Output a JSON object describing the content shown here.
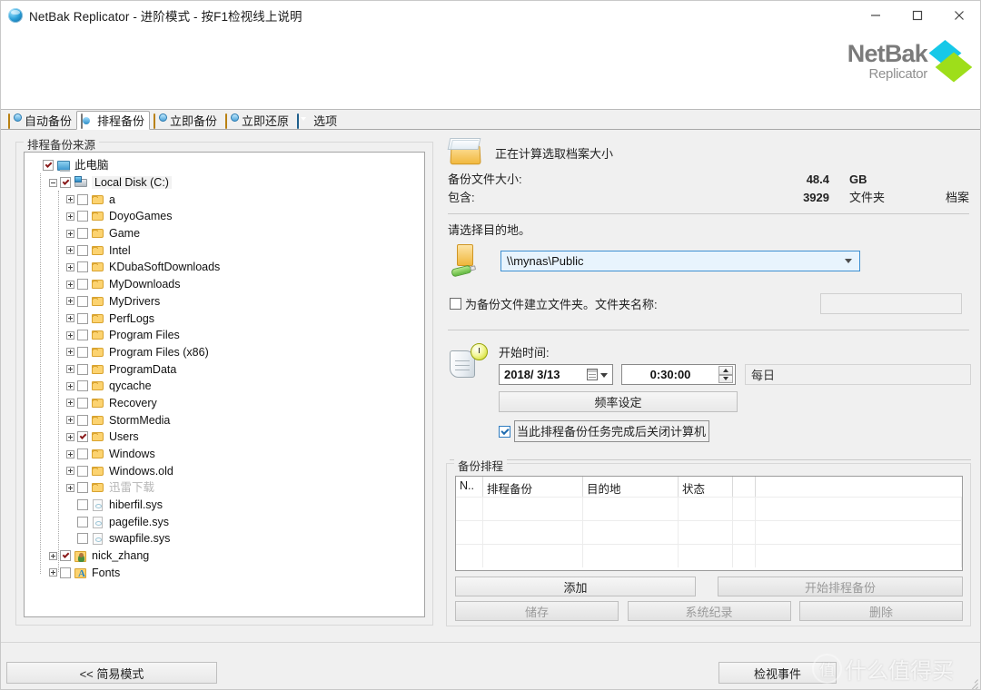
{
  "window": {
    "title": "NetBak Replicator - 进阶模式 - 按F1检视线上说明",
    "icon": "app-globe-icon",
    "minimize": "−",
    "maximize": "□",
    "close": "✕"
  },
  "brand": {
    "name": "NetBak",
    "subtitle": "Replicator",
    "accent_cyan": "#16c8e8",
    "accent_green": "#9ede1a"
  },
  "tabs": [
    {
      "label": "自动备份",
      "icon": "auto-backup-icon",
      "active": false
    },
    {
      "label": "排程备份",
      "icon": "schedule-backup-icon",
      "active": true
    },
    {
      "label": "立即备份",
      "icon": "backup-now-icon",
      "active": false
    },
    {
      "label": "立即还原",
      "icon": "restore-now-icon",
      "active": false
    },
    {
      "label": "选项",
      "icon": "options-icon",
      "active": false
    }
  ],
  "source_group": {
    "title": "排程备份来源",
    "tree": [
      {
        "label": "此电脑",
        "depth": 0,
        "checked": true,
        "expander": "none",
        "icon": "computer-icon",
        "selected": false,
        "dim": false
      },
      {
        "label": "Local Disk (C:)",
        "depth": 1,
        "checked": true,
        "expander": "minus",
        "icon": "drive-icon",
        "selected": true,
        "dim": false
      },
      {
        "label": "a",
        "depth": 2,
        "checked": false,
        "expander": "plus",
        "icon": "folder-icon",
        "selected": false,
        "dim": false
      },
      {
        "label": "DoyoGames",
        "depth": 2,
        "checked": false,
        "expander": "plus",
        "icon": "folder-icon",
        "selected": false,
        "dim": false
      },
      {
        "label": "Game",
        "depth": 2,
        "checked": false,
        "expander": "plus",
        "icon": "folder-icon",
        "selected": false,
        "dim": false
      },
      {
        "label": "Intel",
        "depth": 2,
        "checked": false,
        "expander": "plus",
        "icon": "folder-icon",
        "selected": false,
        "dim": false
      },
      {
        "label": "KDubaSoftDownloads",
        "depth": 2,
        "checked": false,
        "expander": "plus",
        "icon": "folder-icon",
        "selected": false,
        "dim": false
      },
      {
        "label": "MyDownloads",
        "depth": 2,
        "checked": false,
        "expander": "plus",
        "icon": "folder-icon",
        "selected": false,
        "dim": false
      },
      {
        "label": "MyDrivers",
        "depth": 2,
        "checked": false,
        "expander": "plus",
        "icon": "folder-icon",
        "selected": false,
        "dim": false
      },
      {
        "label": "PerfLogs",
        "depth": 2,
        "checked": false,
        "expander": "plus",
        "icon": "folder-icon",
        "selected": false,
        "dim": false
      },
      {
        "label": "Program Files",
        "depth": 2,
        "checked": false,
        "expander": "plus",
        "icon": "folder-icon",
        "selected": false,
        "dim": false
      },
      {
        "label": "Program Files (x86)",
        "depth": 2,
        "checked": false,
        "expander": "plus",
        "icon": "folder-icon",
        "selected": false,
        "dim": false
      },
      {
        "label": "ProgramData",
        "depth": 2,
        "checked": false,
        "expander": "plus",
        "icon": "folder-icon",
        "selected": false,
        "dim": false
      },
      {
        "label": "qycache",
        "depth": 2,
        "checked": false,
        "expander": "plus",
        "icon": "folder-icon",
        "selected": false,
        "dim": false
      },
      {
        "label": "Recovery",
        "depth": 2,
        "checked": false,
        "expander": "plus",
        "icon": "folder-icon",
        "selected": false,
        "dim": false
      },
      {
        "label": "StormMedia",
        "depth": 2,
        "checked": false,
        "expander": "plus",
        "icon": "folder-icon",
        "selected": false,
        "dim": false
      },
      {
        "label": "Users",
        "depth": 2,
        "checked": true,
        "expander": "plus",
        "icon": "folder-icon",
        "selected": false,
        "dim": false
      },
      {
        "label": "Windows",
        "depth": 2,
        "checked": false,
        "expander": "plus",
        "icon": "folder-icon",
        "selected": false,
        "dim": false
      },
      {
        "label": "Windows.old",
        "depth": 2,
        "checked": false,
        "expander": "plus",
        "icon": "folder-icon",
        "selected": false,
        "dim": false
      },
      {
        "label": "迅雷下载",
        "depth": 2,
        "checked": false,
        "expander": "plus",
        "icon": "folder-icon",
        "selected": false,
        "dim": true
      },
      {
        "label": "hiberfil.sys",
        "depth": 2,
        "checked": false,
        "expander": "none",
        "icon": "file-icon",
        "selected": false,
        "dim": false
      },
      {
        "label": "pagefile.sys",
        "depth": 2,
        "checked": false,
        "expander": "none",
        "icon": "file-icon",
        "selected": false,
        "dim": false
      },
      {
        "label": "swapfile.sys",
        "depth": 2,
        "checked": false,
        "expander": "none",
        "icon": "file-icon",
        "selected": false,
        "dim": false
      },
      {
        "label": "nick_zhang",
        "depth": 1,
        "checked": true,
        "expander": "plus",
        "icon": "user-folder-icon",
        "selected": false,
        "dim": false
      },
      {
        "label": "Fonts",
        "depth": 1,
        "checked": false,
        "expander": "plus",
        "icon": "fonts-folder-icon",
        "selected": false,
        "dim": false
      }
    ]
  },
  "calc": {
    "status_text": "正在计算选取档案大小",
    "icon": "open-folder-icon",
    "size_label": "备份文件大小:",
    "size_value": "48.4",
    "size_unit": "GB",
    "contains_label": "包含:",
    "folder_count": "3929",
    "folder_unit": "文件夹",
    "file_unit": "档案"
  },
  "destination": {
    "prompt": "请选择目的地。",
    "icon": "folder-plug-icon",
    "value": "\\\\mynas\\Public",
    "create_folder_checkbox": {
      "label": "为备份文件建立文件夹。文件夹名称:",
      "checked": false
    },
    "folder_name_value": ""
  },
  "schedule": {
    "icon": "scroll-clock-icon",
    "start_label": "开始时间:",
    "date_value": "2018/ 3/13",
    "time_value": "0:30:00",
    "frequency_text": "每日",
    "frequency_button": "频率设定",
    "shutdown_checkbox": {
      "label": "当此排程备份任务完成后关闭计算机",
      "checked": true
    }
  },
  "schedule_group": {
    "title": "备份排程",
    "columns": [
      "N..",
      "排程备份",
      "目的地",
      "状态",
      "",
      ""
    ],
    "rows": [],
    "buttons": {
      "add": "添加",
      "start": "开始排程备份",
      "save": "储存",
      "system_log": "系统纪录",
      "delete": "删除"
    }
  },
  "bottom": {
    "simple_mode": "<< 简易模式",
    "view_events": "检视事件"
  },
  "watermark": {
    "badge": "值",
    "text": "什么值得买"
  }
}
